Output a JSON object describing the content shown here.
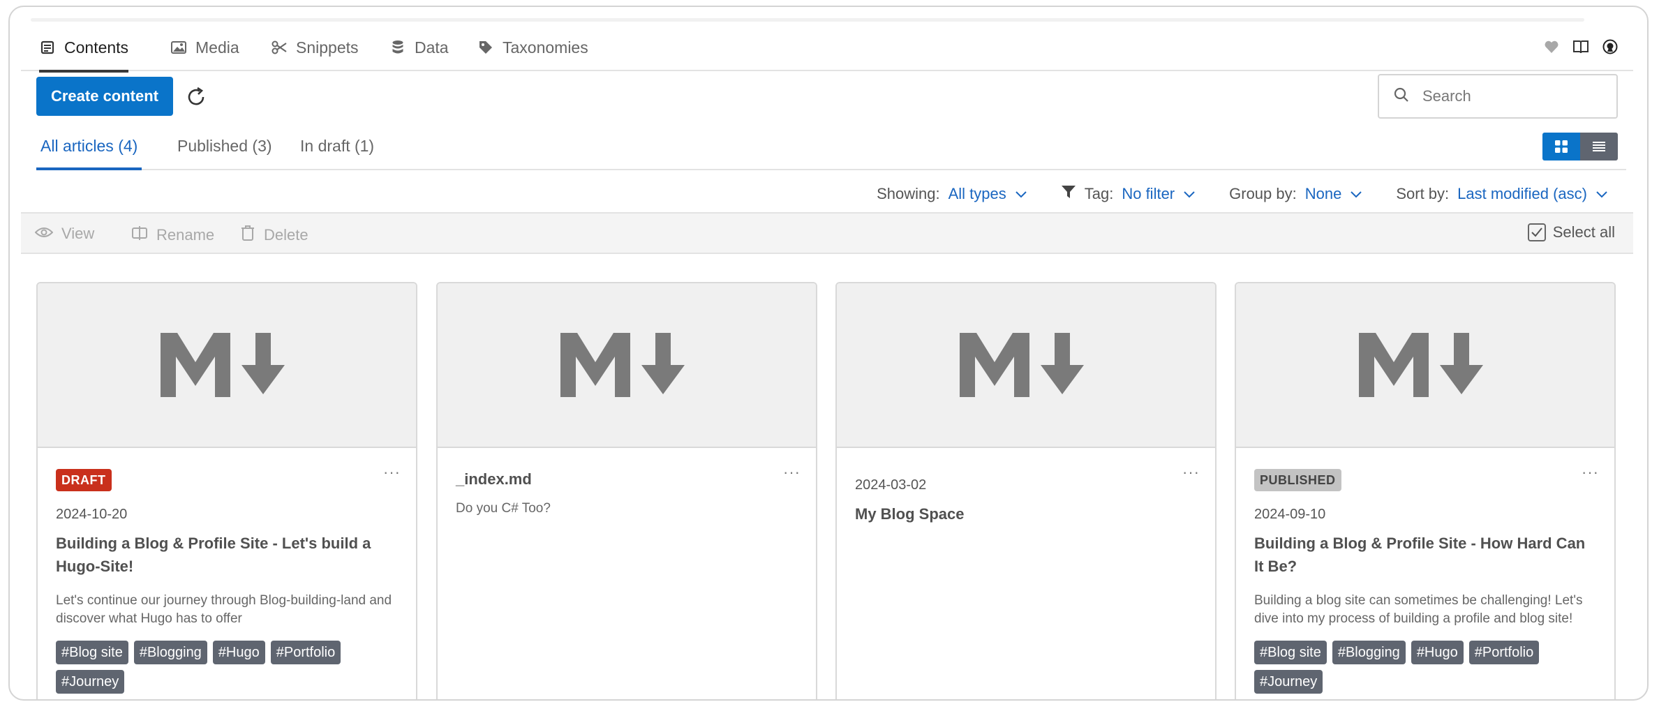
{
  "nav": {
    "tabs": [
      {
        "label": "Contents",
        "icon": "contents-icon"
      },
      {
        "label": "Media",
        "icon": "image-icon"
      },
      {
        "label": "Snippets",
        "icon": "scissors-icon"
      },
      {
        "label": "Data",
        "icon": "database-icon"
      },
      {
        "label": "Taxonomies",
        "icon": "tag-icon"
      }
    ],
    "active": "Contents"
  },
  "toolbar": {
    "create_label": "Create content",
    "search_placeholder": "Search"
  },
  "filter_tabs": {
    "all": "All articles (4)",
    "published": "Published (3)",
    "draft": "In draft (1)"
  },
  "filters": {
    "showing_label": "Showing:",
    "showing_value": "All types",
    "tag_label": "Tag:",
    "tag_value": "No filter",
    "group_label": "Group by:",
    "group_value": "None",
    "sort_label": "Sort by:",
    "sort_value": "Last modified (asc)"
  },
  "actions": {
    "view": "View",
    "rename": "Rename",
    "delete": "Delete",
    "select_all": "Select all"
  },
  "cards": [
    {
      "badge": "DRAFT",
      "date": "2024-10-20",
      "title": "Building a Blog & Profile Site - Let's build a Hugo-Site!",
      "description": "Let's continue our journey through Blog-building-land and discover what Hugo has to offer",
      "tags": [
        "#Blog site",
        "#Blogging",
        "#Hugo",
        "#Portfolio",
        "#Journey"
      ]
    },
    {
      "title": "_index.md",
      "description": "Do you C# Too?"
    },
    {
      "date": "2024-03-02",
      "title": "My Blog Space"
    },
    {
      "badge": "PUBLISHED",
      "date": "2024-09-10",
      "title": "Building a Blog & Profile Site - How Hard Can It Be?",
      "description": "Building a blog site can sometimes be challenging! Let's dive into my process of building a profile and blog site!",
      "tags": [
        "#Blog site",
        "#Blogging",
        "#Hugo",
        "#Portfolio",
        "#Journey"
      ]
    }
  ],
  "colors": {
    "primary": "#0a74c9",
    "link": "#1a66c0",
    "draft": "#c9301c",
    "tag": "#5f6570"
  }
}
